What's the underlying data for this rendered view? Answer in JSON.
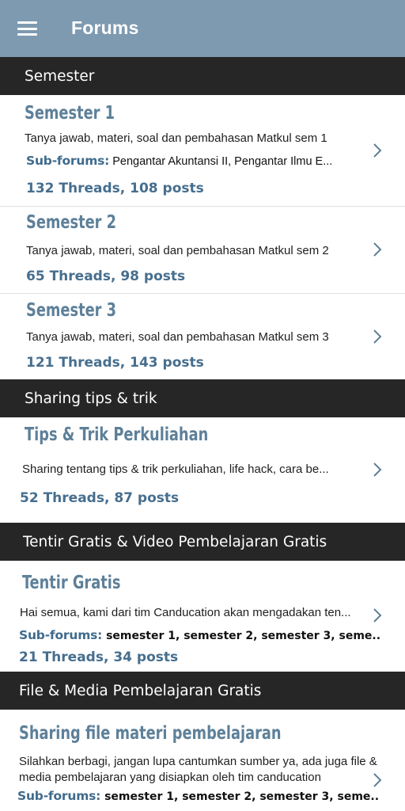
{
  "appbar": {
    "title": "Forums",
    "menu_icon": "hamburger-menu-icon"
  },
  "sections": [
    {
      "header": "Semester",
      "forums": [
        {
          "title": "Semester 1",
          "desc": "Tanya jawab, materi, soal dan pembahasan Matkul sem 1",
          "sub_label": "Sub-forums:",
          "sub": "Pengantar Akuntansi II, Pengantar Ilmu E...",
          "stats": "132 Threads, 108 posts"
        },
        {
          "title": "Semester 2",
          "desc": "Tanya jawab, materi, soal dan pembahasan Matkul sem 2",
          "stats": "65 Threads, 98 posts"
        },
        {
          "title": "Semester 3",
          "desc": "Tanya jawab, materi, soal dan pembahasan Matkul sem 3",
          "stats": "121 Threads, 143 posts"
        }
      ]
    },
    {
      "header": "Sharing tips & trik",
      "forums": [
        {
          "title": "Tips & Trik Perkuliahan",
          "desc": "Sharing tentang tips & trik perkuliahan, life hack, cara be...",
          "stats": "52 Threads, 87 posts"
        }
      ]
    },
    {
      "header": "Tentir Gratis & Video Pembelajaran Gratis",
      "forums": [
        {
          "title": "Tentir Gratis",
          "desc": "Hai semua, kami dari tim Canducation akan mengadakan ten...",
          "sub_label": "Sub-forums:",
          "sub": "semester 1, semester 2, semester 3, seme..",
          "stats": "21 Threads, 34 posts"
        }
      ]
    },
    {
      "header": "File & Media Pembelajaran Gratis",
      "forums": [
        {
          "title": "Sharing file materi pembelajaran",
          "desc": "Silahkan berbagi, jangan lupa cantumkan sumber ya, ada juga file & media pembelajaran yang disiapkan oleh tim canducation",
          "sub_label": "Sub-forums:",
          "sub": "semester 1, semester 2, semester 3, seme.."
        }
      ]
    }
  ]
}
